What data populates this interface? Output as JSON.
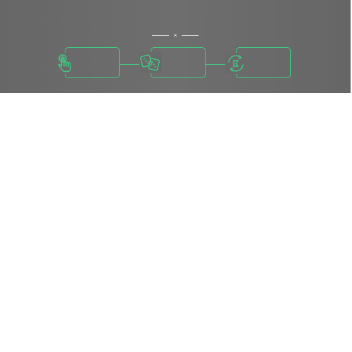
{
  "banner": {
    "heading_mark": "×",
    "accent_color": "#3fca82",
    "background_color": "#6a6a6a",
    "steps": [
      {
        "icon": "hand-pointer-icon"
      },
      {
        "icon": "dice-icon"
      },
      {
        "icon": "rotate-arrows-icon"
      }
    ]
  }
}
